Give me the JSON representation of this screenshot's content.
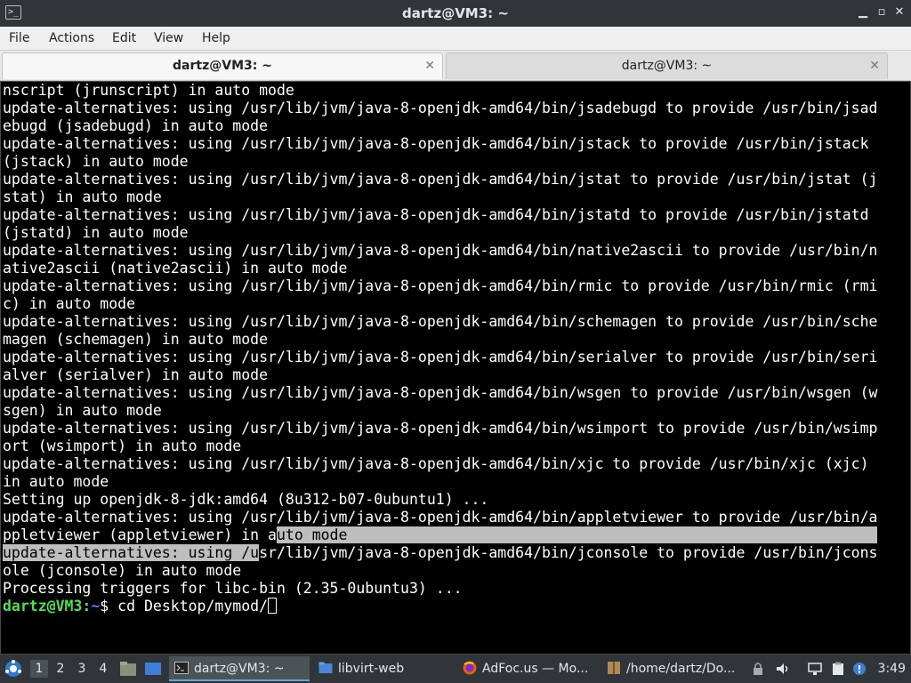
{
  "window": {
    "title": "dartz@VM3: ~",
    "minimize_glyph": "▁",
    "restore_glyph": "▫",
    "close_glyph": "✕"
  },
  "menu": {
    "file": "File",
    "actions": "Actions",
    "edit": "Edit",
    "view": "View",
    "help": "Help"
  },
  "tabs": [
    {
      "label": "dartz@VM3: ~",
      "active": true
    },
    {
      "label": "dartz@VM3: ~",
      "active": false
    }
  ],
  "terminal": {
    "lines": [
      "nscript (jrunscript) in auto mode",
      "update-alternatives: using /usr/lib/jvm/java-8-openjdk-amd64/bin/jsadebugd to provide /usr/bin/jsad",
      "ebugd (jsadebugd) in auto mode",
      "update-alternatives: using /usr/lib/jvm/java-8-openjdk-amd64/bin/jstack to provide /usr/bin/jstack",
      "(jstack) in auto mode",
      "update-alternatives: using /usr/lib/jvm/java-8-openjdk-amd64/bin/jstat to provide /usr/bin/jstat (j",
      "stat) in auto mode",
      "update-alternatives: using /usr/lib/jvm/java-8-openjdk-amd64/bin/jstatd to provide /usr/bin/jstatd",
      "(jstatd) in auto mode",
      "update-alternatives: using /usr/lib/jvm/java-8-openjdk-amd64/bin/native2ascii to provide /usr/bin/n",
      "ative2ascii (native2ascii) in auto mode",
      "update-alternatives: using /usr/lib/jvm/java-8-openjdk-amd64/bin/rmic to provide /usr/bin/rmic (rmi",
      "c) in auto mode",
      "update-alternatives: using /usr/lib/jvm/java-8-openjdk-amd64/bin/schemagen to provide /usr/bin/sche",
      "magen (schemagen) in auto mode",
      "update-alternatives: using /usr/lib/jvm/java-8-openjdk-amd64/bin/serialver to provide /usr/bin/seri",
      "alver (serialver) in auto mode",
      "update-alternatives: using /usr/lib/jvm/java-8-openjdk-amd64/bin/wsgen to provide /usr/bin/wsgen (w",
      "sgen) in auto mode",
      "update-alternatives: using /usr/lib/jvm/java-8-openjdk-amd64/bin/wsimport to provide /usr/bin/wsimp",
      "ort (wsimport) in auto mode",
      "update-alternatives: using /usr/lib/jvm/java-8-openjdk-amd64/bin/xjc to provide /usr/bin/xjc (xjc)",
      "in auto mode",
      "Setting up openjdk-8-jdk:amd64 (8u312-b07-0ubuntu1) ...",
      "update-alternatives: using /usr/lib/jvm/java-8-openjdk-amd64/bin/appletviewer to provide /usr/bin/a"
    ],
    "sel_line1_plain": "ppletviewer (appletviewer) in a",
    "sel_line1_selected": "uto mode                                                            ",
    "sel_line2_selected": "update-alternatives: using /u",
    "sel_line2_plain": "sr/lib/jvm/java-8-openjdk-amd64/bin/jconsole to provide /usr/bin/jcons",
    "after_lines": [
      "ole (jconsole) in auto mode",
      "Processing triggers for libc-bin (2.35-0ubuntu3) ..."
    ],
    "prompt_user": "dartz@VM3",
    "prompt_sep": ":",
    "prompt_path": "~",
    "prompt_symbol": "$ ",
    "command": "cd Desktop/mymod/"
  },
  "taskbar": {
    "workspaces": [
      "1",
      "2",
      "3",
      "4"
    ],
    "tasks": [
      {
        "label": "dartz@VM3: ~",
        "icon": "terminal-icon",
        "active": true
      },
      {
        "label": "libvirt-web",
        "icon": "folder-icon",
        "active": false
      },
      {
        "label": "AdFoc.us — Mo...",
        "icon": "firefox-icon",
        "active": false
      },
      {
        "label": "/home/dartz/Do...",
        "icon": "archive-icon",
        "active": false
      }
    ],
    "clock": "3:49"
  },
  "colors": {
    "prompt_user": "#55dd55",
    "prompt_path": "#5c7cff",
    "selection": "#bebebe",
    "panel": "#2f3539"
  }
}
